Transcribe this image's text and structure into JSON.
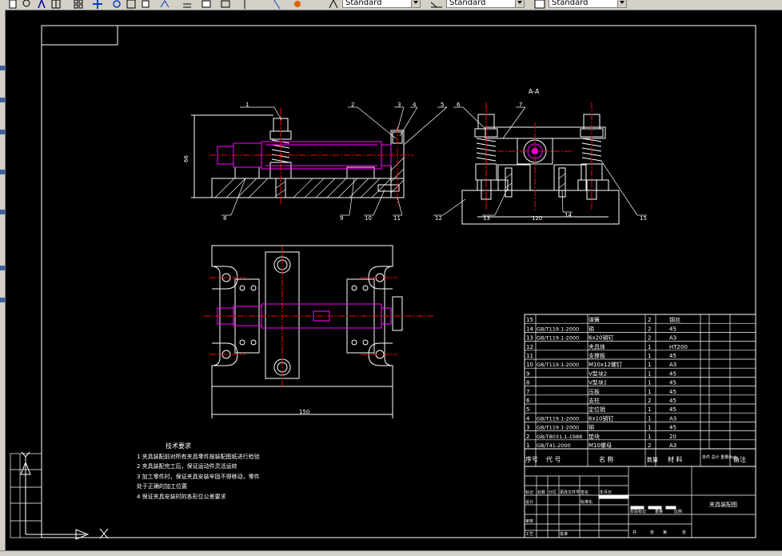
{
  "toolbar": {
    "text_style": "Standard",
    "dim_style": "Standard",
    "table_style": "Standard"
  },
  "drawing": {
    "section_label": "A-A",
    "callouts": [
      "1",
      "2",
      "3",
      "4",
      "5",
      "6",
      "7",
      "8",
      "9",
      "10",
      "11",
      "12",
      "13",
      "14",
      "15"
    ],
    "dimensions": {
      "height": "66",
      "width_section": "120",
      "width_plan": "150"
    },
    "tech_requirements": {
      "title": "技术要求",
      "items": [
        "1  夹具装配前对所有夹具零件按装配图纸进行检验",
        "2  夹具装配完工后，保证运动件灵活运转",
        "3  加工零件时，保证夹具安装牢固不得移动，零件",
        "   处于正确的加工位置",
        "4  保证夹具安装时的各形位公差要求"
      ]
    },
    "parts_list": [
      {
        "no": "15",
        "code": "",
        "name": "弹簧",
        "qty": "2",
        "material": "钢丝"
      },
      {
        "no": "14",
        "code": "GB/T119.1-2000",
        "name": "销",
        "qty": "2",
        "material": "45"
      },
      {
        "no": "13",
        "code": "GB/T119.1-2000",
        "name": "6x20销钉",
        "qty": "2",
        "material": "A3"
      },
      {
        "no": "12",
        "code": "",
        "name": "夹具体",
        "qty": "1",
        "material": "HT200"
      },
      {
        "no": "11",
        "code": "",
        "name": "支撑板",
        "qty": "1",
        "material": "45"
      },
      {
        "no": "10",
        "code": "GB/T119.1-2000",
        "name": "M10x12螺钉",
        "qty": "1",
        "material": "A3"
      },
      {
        "no": "9",
        "code": "",
        "name": "V型块2",
        "qty": "1",
        "material": "45"
      },
      {
        "no": "8",
        "code": "",
        "name": "V型块1",
        "qty": "1",
        "material": "45"
      },
      {
        "no": "7",
        "code": "",
        "name": "压板",
        "qty": "1",
        "material": "45"
      },
      {
        "no": "6",
        "code": "",
        "name": "支柱",
        "qty": "2",
        "material": "45"
      },
      {
        "no": "5",
        "code": "",
        "name": "定位销",
        "qty": "1",
        "material": "45"
      },
      {
        "no": "4",
        "code": "GB/T119.1-2000",
        "name": "6x10销钉",
        "qty": "1",
        "material": "A3"
      },
      {
        "no": "3",
        "code": "GB/T119.1-2000",
        "name": "销",
        "qty": "1",
        "material": "45"
      },
      {
        "no": "2",
        "code": "GB/T8031.1-1988",
        "name": "垫块",
        "qty": "1",
        "material": "20"
      },
      {
        "no": "1",
        "code": "GB/T41-2000",
        "name": "M10螺母",
        "qty": "2",
        "material": "A3"
      }
    ],
    "parts_header": {
      "seq": "序号",
      "code": "代 号",
      "name": "名 称",
      "qty": "数量",
      "material": "材 料",
      "weight": "单件 总计 重量(kg)",
      "remark": "备注"
    },
    "title_block": {
      "drawing_name": "夹具装配图",
      "row_labels": [
        "标记",
        "处数",
        "分区",
        "更改文件号",
        "签名",
        "年月日"
      ],
      "left_labels": [
        "设计",
        "审核",
        "工艺"
      ],
      "std_label": "标准化",
      "approve_label": "批准",
      "stage_labels": [
        "阶段标记",
        "重量",
        "比例"
      ],
      "sheet_labels": [
        "共",
        "张",
        "第",
        "张"
      ]
    }
  }
}
